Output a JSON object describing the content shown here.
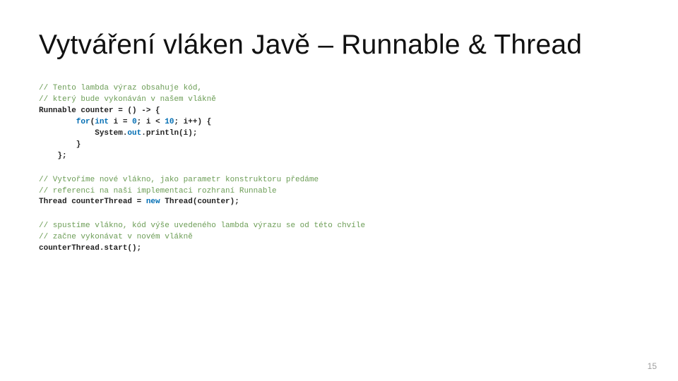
{
  "title": "Vytváření vláken Javě – Runnable & Thread",
  "page_number": "15",
  "code": {
    "b1": {
      "l1": "// Tento lambda výraz obsahuje kód,",
      "l2": "// který bude vykonáván v našem vlákně",
      "l3a": "Runnable counter = () -> {",
      "l4a": "        for",
      "l4b": "(",
      "l4c": "int",
      "l4d": " i = ",
      "l4e": "0",
      "l4f": "; i < ",
      "l4g": "10",
      "l4h": "; i++) {",
      "l5a": "            System.",
      "l5b": "out",
      "l5c": ".println(i);",
      "l6": "        }",
      "l7": "    };"
    },
    "b2": {
      "l1": "// Vytvoříme nové vlákno, jako parametr konstruktoru předáme",
      "l2": "// referenci na naši implementaci rozhraní Runnable",
      "l3a": "Thread counterThread = ",
      "l3b": "new",
      "l3c": " Thread(counter);"
    },
    "b3": {
      "l1": "// spustíme vlákno, kód výše uvedeného lambda výrazu se od této chvíle",
      "l2": "// začne vykonávat v novém vlákně",
      "l3": "counterThread.start();"
    }
  }
}
